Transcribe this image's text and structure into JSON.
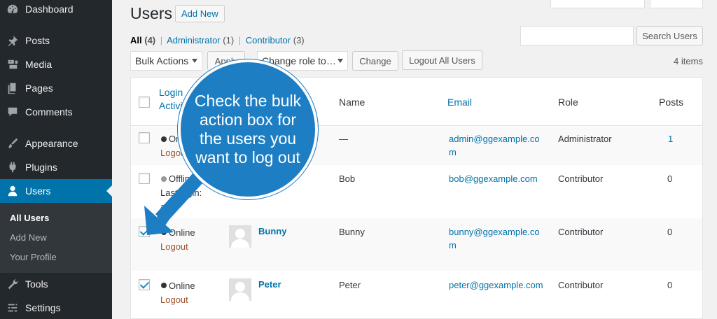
{
  "sidebar": {
    "items": [
      {
        "label": "Dashboard",
        "icon": "dashboard-icon"
      },
      {
        "label": "Posts",
        "icon": "pin-icon"
      },
      {
        "label": "Media",
        "icon": "media-icon"
      },
      {
        "label": "Pages",
        "icon": "pages-icon"
      },
      {
        "label": "Comments",
        "icon": "comment-icon"
      },
      {
        "label": "Appearance",
        "icon": "paintbrush-icon"
      },
      {
        "label": "Plugins",
        "icon": "plugin-icon"
      },
      {
        "label": "Users",
        "icon": "user-icon"
      },
      {
        "label": "Tools",
        "icon": "wrench-icon"
      },
      {
        "label": "Settings",
        "icon": "settings-icon"
      }
    ],
    "submenu": [
      "All Users",
      "Add New",
      "Your Profile"
    ]
  },
  "header": {
    "title": "Users",
    "add_new": "Add New"
  },
  "views": {
    "all": "All",
    "all_count": "(4)",
    "administrator": "Administrator",
    "administrator_count": "(1)",
    "contributor": "Contributor",
    "contributor_count": "(3)",
    "separator": "|"
  },
  "search": {
    "placeholder": "",
    "button": "Search Users"
  },
  "tablenav": {
    "bulk_actions": "Bulk Actions",
    "apply": "Apply",
    "change_role": "Change role to…",
    "change": "Change",
    "logout_all": "Logout All Users",
    "items": "4 items"
  },
  "table": {
    "headers": {
      "login_activity": "Login Activity",
      "name": "Name",
      "email": "Email",
      "role": "Role",
      "posts": "Posts"
    },
    "rows": [
      {
        "status": "Online",
        "action": "Logout",
        "username": "",
        "name": "—",
        "email": "admin@ggexample.com",
        "role": "Administrator",
        "posts": "1",
        "checked": false
      },
      {
        "status": "Offline",
        "last_login_label": "Last login:",
        "last_login": "ago",
        "username": "",
        "name": "Bob",
        "email": "bob@ggexample.com",
        "role": "Contributor",
        "posts": "0",
        "checked": false
      },
      {
        "status": "Online",
        "action": "Logout",
        "username": "Bunny",
        "name": "Bunny",
        "email": "bunny@ggexample.com",
        "role": "Contributor",
        "posts": "0",
        "checked": true
      },
      {
        "status": "Online",
        "action": "Logout",
        "username": "Peter",
        "name": "Peter",
        "email": "peter@ggexample.com",
        "role": "Contributor",
        "posts": "0",
        "checked": true
      }
    ]
  },
  "callout": {
    "text": "Check the bulk action box for the users you want to log out",
    "color": "#1d7ec4"
  },
  "colors": {
    "sidebar_bg": "#23282d",
    "accent": "#0073aa",
    "logout": "#a0522d"
  }
}
